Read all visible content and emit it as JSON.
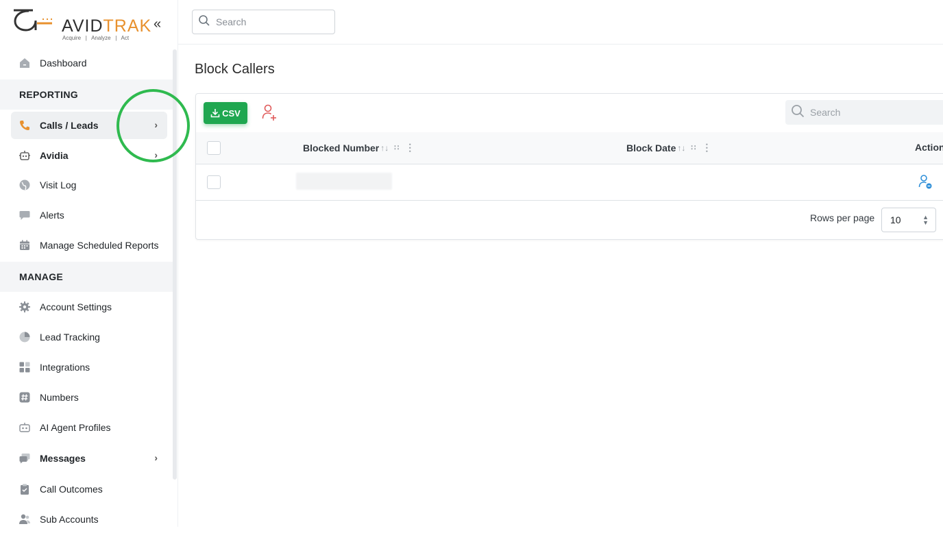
{
  "brand": {
    "name_part1": "AVID",
    "name_part2": "TRAK",
    "tagline": "Acquire   |   Analyze   |   Act",
    "collapse_icon": "«"
  },
  "sidebar": {
    "top_items": [
      {
        "label": "Dashboard",
        "icon": "home-icon"
      }
    ],
    "section_reporting": "REPORTING",
    "reporting_items": [
      {
        "label": "Calls / Leads",
        "icon": "phone-icon",
        "active": true,
        "has_submenu": true
      },
      {
        "label": "Avidia",
        "icon": "robot-icon",
        "has_submenu": true
      },
      {
        "label": "Visit Log",
        "icon": "globe-icon"
      },
      {
        "label": "Alerts",
        "icon": "chat-icon"
      },
      {
        "label": "Manage Scheduled Reports",
        "icon": "calendar-icon"
      }
    ],
    "section_manage": "MANAGE",
    "manage_items": [
      {
        "label": "Account Settings",
        "icon": "gear-icon"
      },
      {
        "label": "Lead Tracking",
        "icon": "pie-chart-icon"
      },
      {
        "label": "Integrations",
        "icon": "grid-icon"
      },
      {
        "label": "Numbers",
        "icon": "hash-icon"
      },
      {
        "label": "AI Agent Profiles",
        "icon": "agent-icon"
      },
      {
        "label": "Messages",
        "icon": "messages-icon",
        "has_submenu": true
      },
      {
        "label": "Call Outcomes",
        "icon": "clipboard-icon"
      },
      {
        "label": "Sub Accounts",
        "icon": "users-icon"
      }
    ],
    "chevron": "›"
  },
  "topbar": {
    "search_placeholder": "Search"
  },
  "page": {
    "title": "Block Callers"
  },
  "toolbar": {
    "csv_label": "CSV",
    "search_placeholder": "Search"
  },
  "table": {
    "columns": [
      {
        "label": "Blocked Number"
      },
      {
        "label": "Block Date"
      },
      {
        "label": "Action"
      }
    ],
    "sort_glyph": "↑↓",
    "grip_glyph": "∷",
    "kebab_glyph": "⋮"
  },
  "pagination": {
    "rows_per_page_label": "Rows per page",
    "rows_per_page_value": "10"
  },
  "colors": {
    "accent_green": "#1fa750",
    "brand_orange": "#e8912e",
    "add_user_red": "#e05a5a",
    "action_blue": "#2f8fd8"
  }
}
